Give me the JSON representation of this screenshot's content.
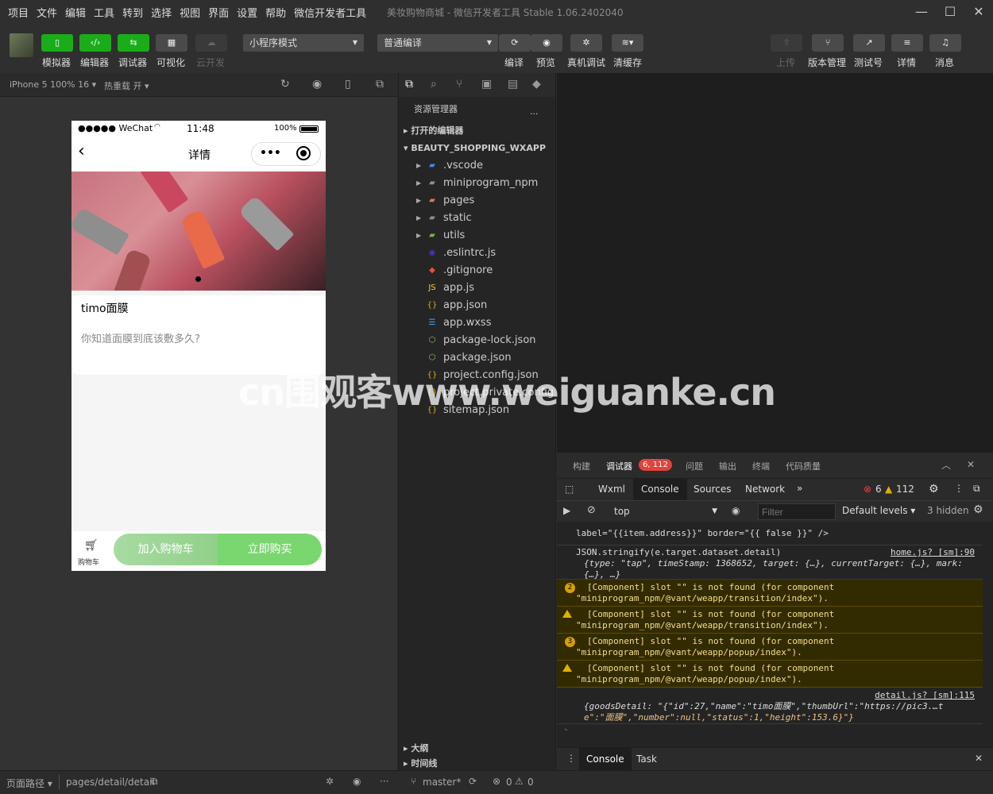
{
  "menubar": {
    "items": [
      "项目",
      "文件",
      "编辑",
      "工具",
      "转到",
      "选择",
      "视图",
      "界面",
      "设置",
      "帮助",
      "微信开发者工具"
    ],
    "title": "美妆购物商城 - 微信开发者工具 Stable 1.06.2402040"
  },
  "toolbar": {
    "left_buttons": [
      {
        "label": "模拟器",
        "icon": "phone-icon"
      },
      {
        "label": "编辑器",
        "icon": "code-icon"
      },
      {
        "label": "调试器",
        "icon": "debug-icon"
      },
      {
        "label": "可视化",
        "icon": "layout-icon"
      },
      {
        "label": "云开发",
        "icon": "cloud-icon"
      }
    ],
    "mode_select": "小程序模式",
    "compile_select": "普通编译",
    "mid_buttons": [
      {
        "label": "编译",
        "icon": "refresh-icon"
      },
      {
        "label": "预览",
        "icon": "eye-icon"
      },
      {
        "label": "真机调试",
        "icon": "bug-icon"
      },
      {
        "label": "清缓存",
        "icon": "layers-icon"
      }
    ],
    "right_buttons": [
      {
        "label": "上传",
        "icon": "upload-icon"
      },
      {
        "label": "版本管理",
        "icon": "branch-icon"
      },
      {
        "label": "测试号",
        "icon": "external-icon"
      },
      {
        "label": "详情",
        "icon": "menu-icon"
      },
      {
        "label": "消息",
        "icon": "bell-icon"
      }
    ]
  },
  "simulator": {
    "device": "iPhone 5 100% 16",
    "hot_reload": "热重载 开",
    "status": {
      "carrier": "●●●●● WeChat",
      "time": "11:48",
      "battery": "100%"
    },
    "nav_title": "详情",
    "product_name": "timo面膜",
    "product_desc": "你知道面膜到底该敷多久?",
    "cart_label": "购物车",
    "add_cart": "加入购物车",
    "buy_now": "立即购买"
  },
  "explorer": {
    "title": "资源管理器",
    "open_editors": "打开的编辑器",
    "project": "BEAUTY_SHOPPING_WXAPP",
    "files": [
      {
        "name": ".vscode",
        "type": "folder",
        "icon": "vscode-folder-icon"
      },
      {
        "name": "miniprogram_npm",
        "type": "folder",
        "icon": "folder-icon"
      },
      {
        "name": "pages",
        "type": "folder",
        "icon": "pages-folder-icon"
      },
      {
        "name": "static",
        "type": "folder",
        "icon": "folder-icon"
      },
      {
        "name": "utils",
        "type": "folder",
        "icon": "utils-folder-icon"
      },
      {
        "name": ".eslintrc.js",
        "type": "file",
        "icon": "eslint-icon"
      },
      {
        "name": ".gitignore",
        "type": "file",
        "icon": "git-icon"
      },
      {
        "name": "app.js",
        "type": "file",
        "icon": "js-icon"
      },
      {
        "name": "app.json",
        "type": "file",
        "icon": "json-icon"
      },
      {
        "name": "app.wxss",
        "type": "file",
        "icon": "css-icon"
      },
      {
        "name": "package-lock.json",
        "type": "file",
        "icon": "npm-icon"
      },
      {
        "name": "package.json",
        "type": "file",
        "icon": "npm-icon"
      },
      {
        "name": "project.config.json",
        "type": "file",
        "icon": "json-icon"
      },
      {
        "name": "project.private.config.js...",
        "type": "file",
        "icon": "json-icon"
      },
      {
        "name": "sitemap.json",
        "type": "file",
        "icon": "json-icon"
      }
    ],
    "outline": "大纲",
    "timeline": "时间线"
  },
  "devtools": {
    "top_tabs": [
      "构建",
      "调试器",
      "问题",
      "输出",
      "终端",
      "代码质量"
    ],
    "debugger_badge": "6, 112",
    "panel_tabs": [
      "Wxml",
      "Console",
      "Sources",
      "Network"
    ],
    "errors": "6",
    "warnings": "112",
    "context": "top",
    "filter_placeholder": "Filter",
    "levels": "Default levels",
    "hidden": "3 hidden",
    "lines": [
      {
        "kind": "log",
        "text": "label=\"{{item.address}}\" border=\"{{ false }}\" />"
      },
      {
        "kind": "log",
        "text": "JSON.stringify(e.target.dataset.detail)",
        "link": "home.js? [sm]:90"
      },
      {
        "kind": "log",
        "text": "{type: \"tap\", timeStamp: 1368652, target: {…}, currentTarget: {…}, mark:"
      },
      {
        "kind": "log",
        "text": "{…}, …}"
      },
      {
        "kind": "warn",
        "count": "2",
        "text": "[Component] slot \"\" is not found (for component",
        "text2": "\"miniprogram_npm/@vant/weapp/transition/index\")."
      },
      {
        "kind": "warn",
        "count": "",
        "text": "[Component] slot \"\" is not found (for component",
        "text2": "\"miniprogram_npm/@vant/weapp/transition/index\")."
      },
      {
        "kind": "warn",
        "count": "3",
        "text": "[Component] slot \"\" is not found (for component",
        "text2": "\"miniprogram_npm/@vant/weapp/popup/index\")."
      },
      {
        "kind": "warn",
        "count": "",
        "text": "[Component] slot \"\" is not found (for component",
        "text2": "\"miniprogram_npm/@vant/weapp/popup/index\")."
      },
      {
        "kind": "log",
        "link": "detail.js? [sm]:115",
        "text": "{goodsDetail: \"{\"id\":27,\"name\":\"timo面膜\",\"thumbUrl\":\"https://pic3.…t",
        "text2": "e\":\"面膜\",\"number\":null,\"status\":1,\"height\":153.6}\"}"
      }
    ],
    "drawer_tabs": [
      "Console",
      "Task"
    ]
  },
  "statusbar": {
    "page_path_label": "页面路径",
    "page_path": "pages/detail/detail",
    "branch": "master*",
    "errors": "0",
    "warnings": "0"
  },
  "watermark": "cn围观客www.weiguanke.cn",
  "colors": {
    "accent_green": "#1aad19",
    "buy_green": "#7ad66f",
    "warn_bg": "#332b00",
    "badge_red": "#e0443e"
  }
}
